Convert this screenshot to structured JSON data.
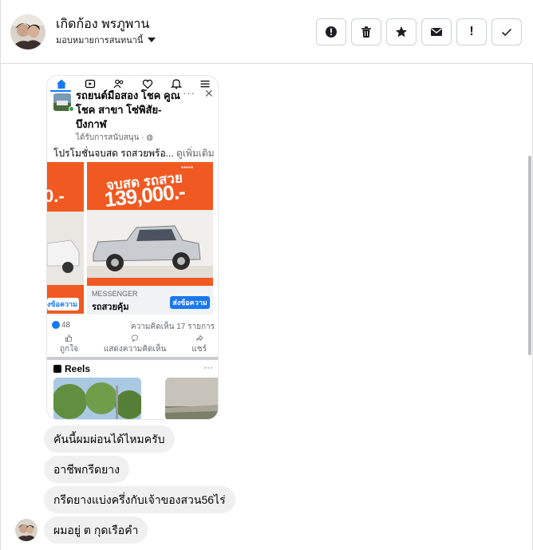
{
  "header": {
    "contact_name": "เกิดก้อง พรภูพาน",
    "assign_label": "มอบหมายการสนทนานี้",
    "actions": [
      {
        "icon": "alert-circle-icon",
        "label": "Mark as spam"
      },
      {
        "icon": "trash-icon",
        "label": "Delete"
      },
      {
        "icon": "star-icon",
        "label": "Star"
      },
      {
        "icon": "envelope-icon",
        "label": "Mark as unread"
      },
      {
        "icon": "exclamation-icon",
        "label": "Follow up"
      },
      {
        "icon": "check-icon",
        "label": "Done"
      }
    ]
  },
  "shared_screenshot": {
    "post_title": "รถยนต์มือสอง โชค คูณโชค สาขา โซ่พิสัย-บึงกาฬ",
    "sponsored": "ได้รับการสนับสนุน ·",
    "caption_text": "โปรโมชั่นจบสด รถสวยพร้อ...",
    "caption_more": "ดูเพิ่มเติม",
    "left_ad_big": "0.-",
    "left_ad_cta": "่งข้อความ",
    "ad_headline": "จบสด รถสวย",
    "ad_price": "139,000.-",
    "ad_label": "MESSENGER",
    "ad_text": "รถสวยคุ้ม",
    "ad_cta": "ส่งข้อความ",
    "likes": "48",
    "comments": "ความคิดเห็น 17 รายการ",
    "action_like": "ถูกใจ",
    "action_comment": "แสดงความคิดเห็น",
    "action_share": "แชร์",
    "reels_title": "Reels",
    "more": "···"
  },
  "messages": [
    "คันนี้ผมผ่อนได้ไหมครับ",
    "อาชีพกรีดยาง",
    "กรีดยางแบ่งครึ่งกับเจ้าของสวน56ไร่",
    "ผมอยู่ ต กุดเรือคำ"
  ],
  "colors": {
    "facebook_blue": "#1877f2",
    "ad_orange": "#f05a22",
    "bubble_gray": "#f0f0f0"
  }
}
